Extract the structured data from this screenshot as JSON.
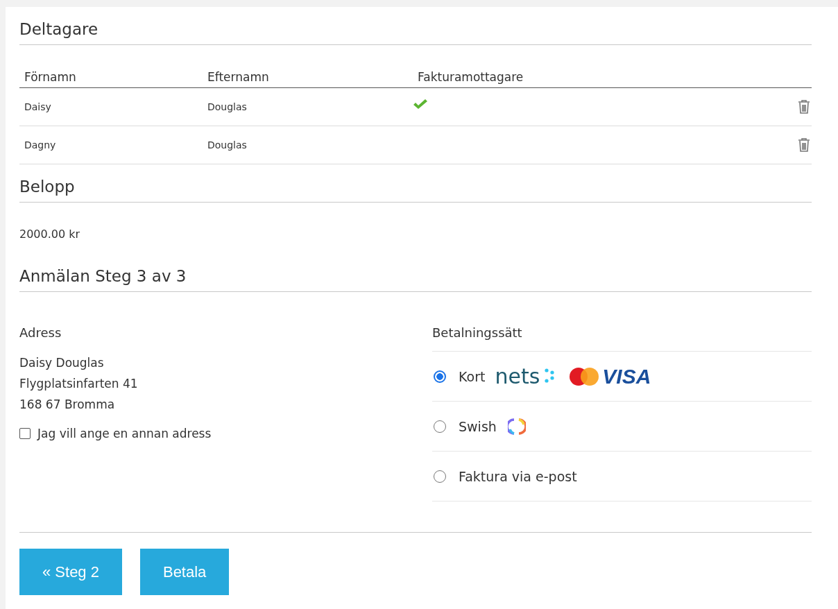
{
  "participants": {
    "heading": "Deltagare",
    "columns": [
      "Förnamn",
      "Efternamn",
      "Fakturamottagare"
    ],
    "rows": [
      {
        "first_name": "Daisy",
        "last_name": "Douglas",
        "invoice_recipient": true
      },
      {
        "first_name": "Dagny",
        "last_name": "Douglas",
        "invoice_recipient": false
      }
    ]
  },
  "amount": {
    "heading": "Belopp",
    "value": "2000.00 kr"
  },
  "step": {
    "heading": "Anmälan Steg 3 av 3"
  },
  "address": {
    "heading": "Adress",
    "lines": [
      "Daisy Douglas",
      "Flygplatsinfarten 41",
      "168 67 Bromma"
    ],
    "other_address": {
      "label": "Jag vill ange en annan adress",
      "checked": false
    }
  },
  "payment": {
    "heading": "Betalningssätt",
    "options": [
      {
        "kind": "card",
        "label": "Kort",
        "selected": true,
        "logo_texts": [
          "nets",
          "VISA"
        ]
      },
      {
        "kind": "swish",
        "label": "Swish",
        "selected": false
      },
      {
        "kind": "invoice",
        "label": "Faktura via e-post",
        "selected": false
      }
    ]
  },
  "buttons": [
    {
      "label": "« Steg 2"
    },
    {
      "label": "Betala"
    }
  ]
}
